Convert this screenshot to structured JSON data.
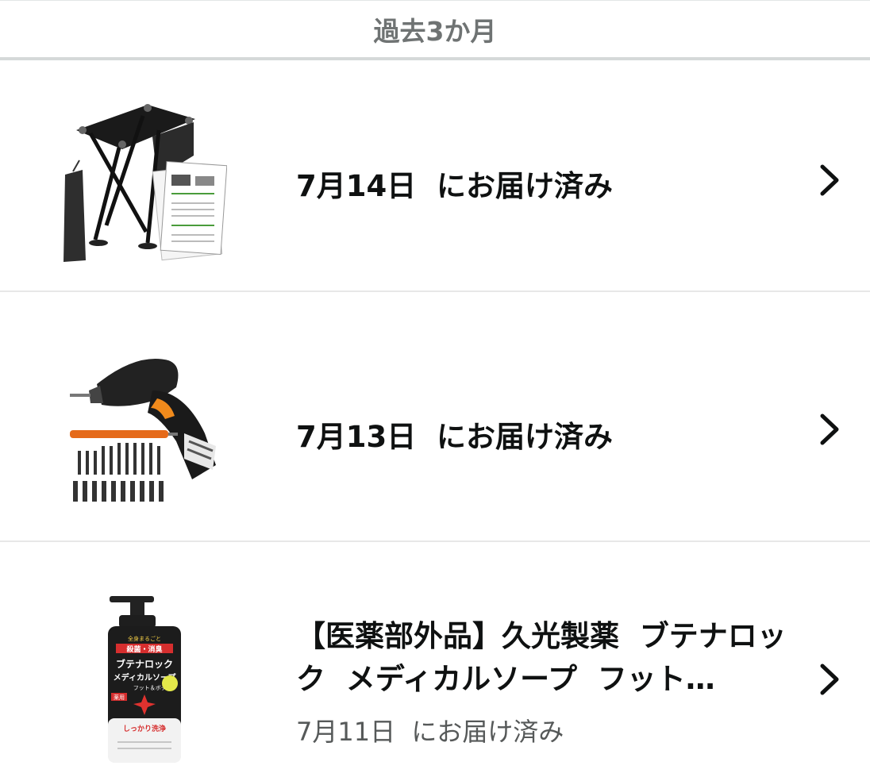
{
  "section": {
    "title": "過去3か月"
  },
  "orders": [
    {
      "delivery_status": "7月14日  にお届け済み",
      "thumbnail": "folding-stool-icon"
    },
    {
      "delivery_status": "7月13日  にお届け済み",
      "thumbnail": "electric-screwdriver-icon"
    },
    {
      "product_title": "【医薬部外品】久光製薬  ブテナロック  メディカルソープ  フット…",
      "delivery_status": "7月11日  にお届け済み",
      "thumbnail": "medical-soap-bottle-icon",
      "bottle_text": {
        "top": "全身まるごと",
        "headline": "殺菌・消臭",
        "brand": "ブテナロック",
        "product": "メディカルソープ",
        "variant": "フット＆ボディ",
        "badge": "薬用",
        "tagline": "しっかり洗浄"
      }
    }
  ],
  "colors": {
    "header_text": "#6f7373",
    "divider": "#e7e7e7",
    "secondary_text": "#565959"
  }
}
